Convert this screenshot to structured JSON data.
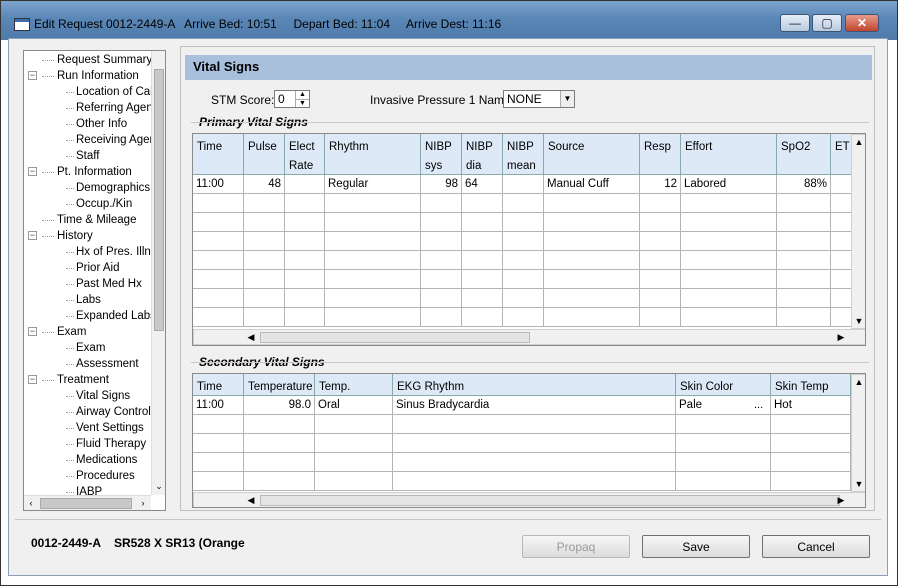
{
  "window": {
    "title": "Edit Request 0012-2449-A   Arrive Bed: 10:51     Depart Bed: 11:04     Arrive Dest: 11:16",
    "minimize_glyph": "—",
    "maximize_glyph": "▢",
    "close_glyph": "✕"
  },
  "tree": {
    "items": [
      {
        "label": "Request Summary",
        "level": 0
      },
      {
        "label": "Run Information",
        "level": 0,
        "expanded": true
      },
      {
        "label": "Location of Call",
        "level": 1
      },
      {
        "label": "Referring Agency",
        "level": 1
      },
      {
        "label": "Other Info",
        "level": 1
      },
      {
        "label": "Receiving Agency",
        "level": 1
      },
      {
        "label": "Staff",
        "level": 1
      },
      {
        "label": "Pt. Information",
        "level": 0,
        "expanded": true
      },
      {
        "label": "Demographics",
        "level": 1
      },
      {
        "label": "Occup./Kin",
        "level": 1
      },
      {
        "label": "Time & Mileage",
        "level": 0
      },
      {
        "label": "History",
        "level": 0,
        "expanded": true
      },
      {
        "label": "Hx of Pres. Illness",
        "level": 1
      },
      {
        "label": "Prior Aid",
        "level": 1
      },
      {
        "label": "Past Med Hx",
        "level": 1
      },
      {
        "label": "Labs",
        "level": 1
      },
      {
        "label": "Expanded Labs",
        "level": 1
      },
      {
        "label": "Exam",
        "level": 0,
        "expanded": true
      },
      {
        "label": "Exam",
        "level": 1
      },
      {
        "label": "Assessment",
        "level": 1
      },
      {
        "label": "Treatment",
        "level": 0,
        "expanded": true
      },
      {
        "label": "Vital Signs",
        "level": 1
      },
      {
        "label": "Airway Control",
        "level": 1
      },
      {
        "label": "Vent Settings",
        "level": 1
      },
      {
        "label": "Fluid Therapy",
        "level": 1
      },
      {
        "label": "Medications",
        "level": 1
      },
      {
        "label": "Procedures",
        "level": 1
      },
      {
        "label": "IABP",
        "level": 1
      }
    ],
    "expand_glyph": "−"
  },
  "panel": {
    "title": "Vital Signs",
    "stm_label": "STM Score:",
    "stm_value": "0",
    "invasive_label": "Invasive Pressure 1 Name:",
    "invasive_value": "NONE"
  },
  "primary": {
    "title": "Primary Vital Signs",
    "headers": [
      [
        "Time",
        ""
      ],
      [
        "Pulse",
        ""
      ],
      [
        "Elect",
        "Rate"
      ],
      [
        "Rhythm",
        ""
      ],
      [
        "NIBP",
        "sys"
      ],
      [
        "NIBP",
        "dia"
      ],
      [
        "NIBP",
        "mean"
      ],
      [
        "Source",
        ""
      ],
      [
        "Resp",
        ""
      ],
      [
        "Effort",
        ""
      ],
      [
        "SpO2",
        ""
      ],
      [
        "ET",
        ""
      ]
    ],
    "rows": [
      [
        "11:00",
        "48",
        "",
        "Regular",
        "98",
        "64",
        "",
        "Manual Cuff",
        "12",
        "Labored",
        "88%",
        ""
      ]
    ]
  },
  "secondary": {
    "title": "Secondary Vital Signs",
    "headers": [
      "Time",
      "Temperature",
      "Temp. Method",
      "EKG Rhythm",
      "Skin Color",
      "Skin Temp"
    ],
    "rows": [
      [
        "11:00",
        "98.0",
        "Oral",
        "Sinus Bradycardia",
        "Pale",
        "Hot"
      ]
    ],
    "ellipsis": "..."
  },
  "footer": {
    "request_info": "0012-2449-A    SR528 X SR13 (Orange",
    "propaq_label": "Propaq",
    "save_label": "Save",
    "cancel_label": "Cancel"
  },
  "colors": {
    "title_gradient": "#5b87b7",
    "grid_header": "#dde9f7",
    "panel_header": "#a9c0dd"
  }
}
